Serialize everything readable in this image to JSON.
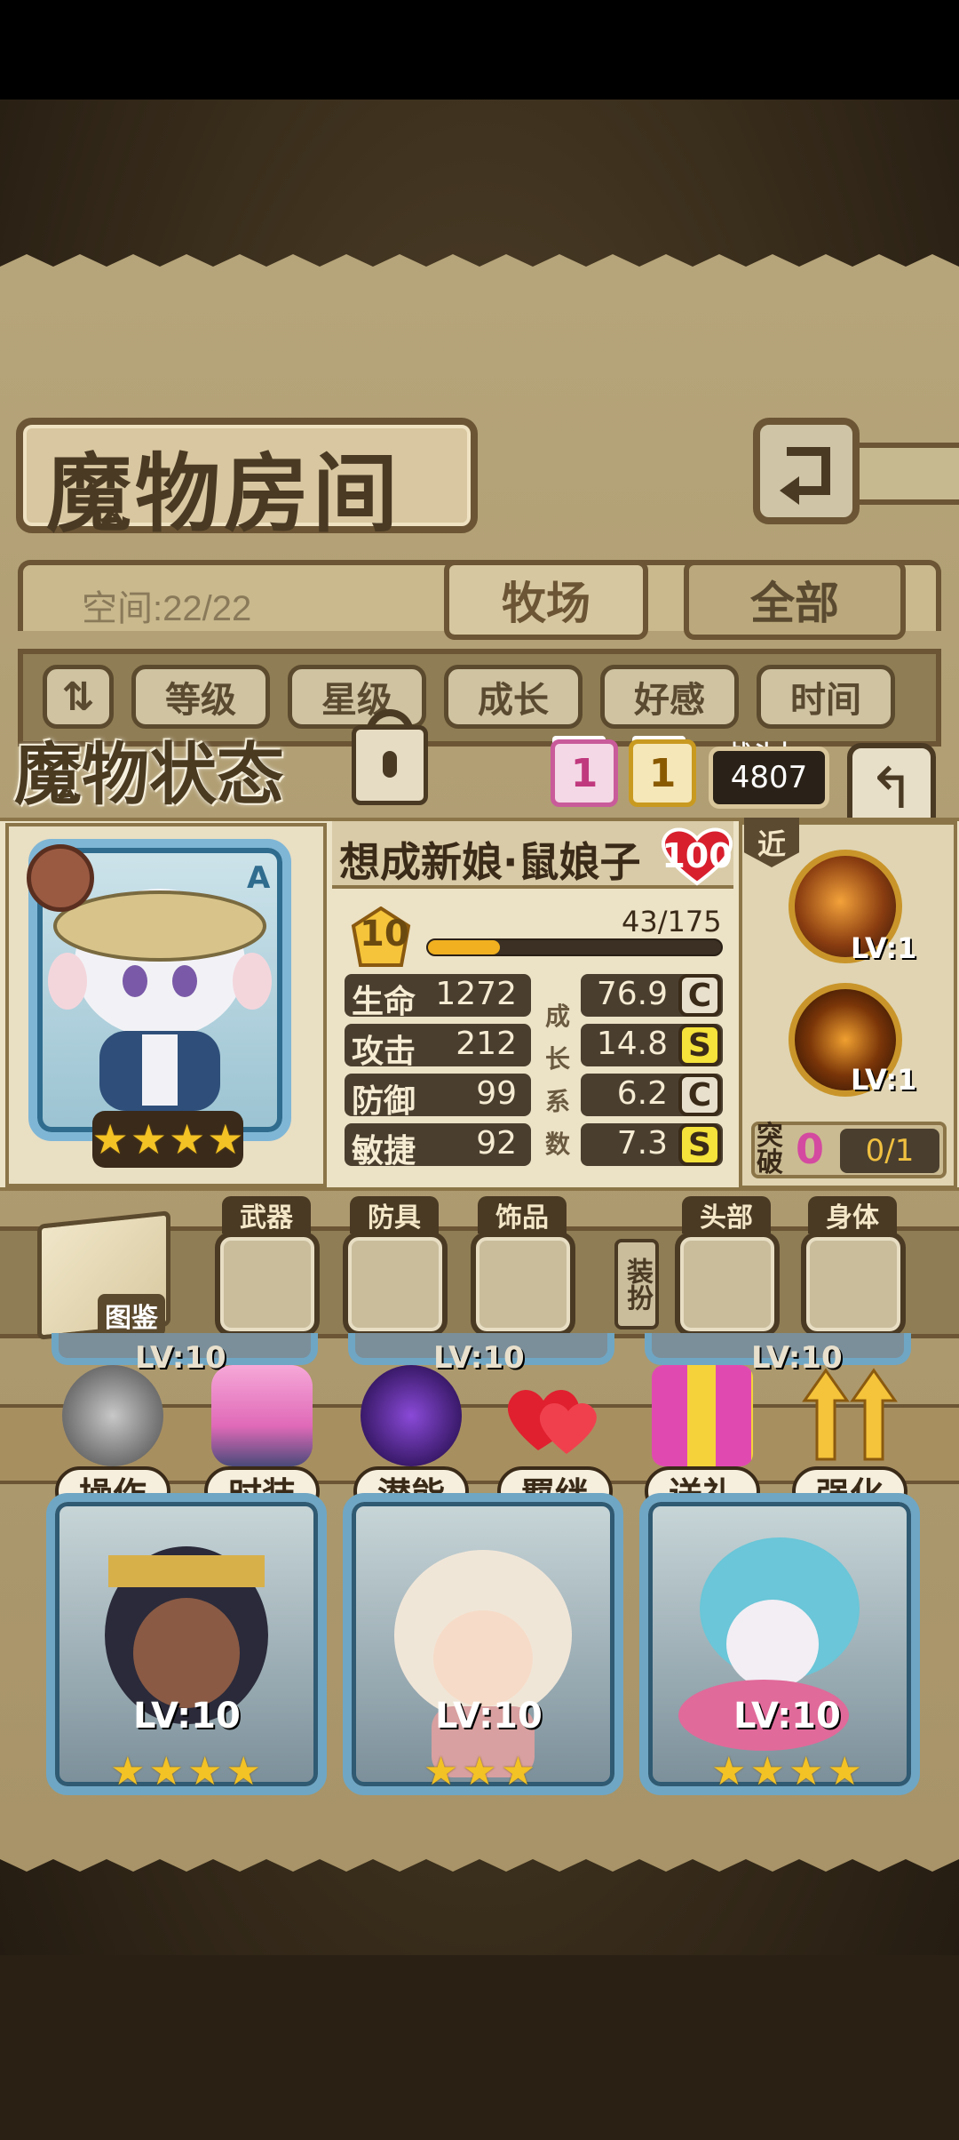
{
  "header": {
    "title": "魔物房间"
  },
  "storage": {
    "space": "空间:22/22"
  },
  "tabs": [
    {
      "label": "牧场"
    },
    {
      "label": "全部"
    }
  ],
  "sort_buttons": [
    "等级",
    "星级",
    "成长",
    "好感",
    "时间"
  ],
  "status": {
    "title": "魔物状态",
    "bond_label": "羁绊",
    "bond_value": "1",
    "potential_label": "潜能",
    "potential_value": "1",
    "power_label": "战斗力",
    "power_value": "4807"
  },
  "character": {
    "name": "想成新娘·鼠娘子",
    "grade": "A",
    "affection": "100",
    "level": "10",
    "exp": "43/175",
    "exp_fraction": 0.246,
    "stars": 4,
    "stats": [
      {
        "label": "生命",
        "value": "1272",
        "growth": "76.9",
        "grade": "C"
      },
      {
        "label": "攻击",
        "value": "212",
        "growth": "14.8",
        "grade": "S"
      },
      {
        "label": "防御",
        "value": "99",
        "growth": "6.2",
        "grade": "C"
      },
      {
        "label": "敏捷",
        "value": "92",
        "growth": "7.3",
        "grade": "S"
      }
    ],
    "growth_vertical": [
      "成",
      "长",
      "系",
      "数"
    ],
    "range_tag": "近",
    "skills": [
      {
        "level": "LV:1"
      },
      {
        "level": "LV:1"
      }
    ],
    "breakthrough_label": "突破",
    "breakthrough_value": "0",
    "breakthrough_progress": "0/1"
  },
  "equipment": {
    "book_label": "图鉴",
    "slots": [
      "武器",
      "防具",
      "饰品",
      "头部",
      "身体"
    ],
    "dress_label": "装扮"
  },
  "actions": [
    "操作",
    "时装",
    "潜能",
    "羁绊",
    "送礼",
    "强化"
  ],
  "top_card_levels": [
    "LV:10",
    "LV:10",
    "LV:10"
  ],
  "cards": [
    {
      "level": "LV:10",
      "stars": 4
    },
    {
      "level": "LV:10",
      "stars": 3
    },
    {
      "level": "LV:10",
      "stars": 4
    }
  ],
  "colors": {
    "grade_C": "#e8e0cc",
    "grade_S": "#f5e23a",
    "star": "#f3c224",
    "accent_pink": "#d24c8f"
  }
}
